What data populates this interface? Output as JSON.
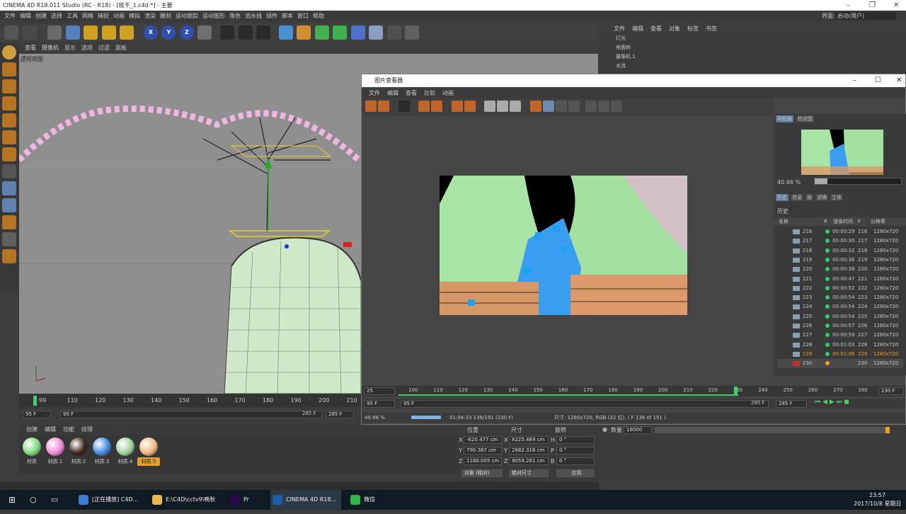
{
  "window": {
    "title": "CINEMA 4D R18.011 Studio (RC - R18) - [枝干_1.c4d *] - 主要",
    "interface_label": "界面:",
    "interface_value": "启动(用户)"
  },
  "menu": [
    "文件",
    "编辑",
    "创建",
    "选择",
    "工具",
    "网格",
    "捕捉",
    "动画",
    "模拟",
    "渲染",
    "雕刻",
    "运动跟踪",
    "运动图形",
    "角色",
    "流水线",
    "插件",
    "脚本",
    "窗口",
    "帮助"
  ],
  "toolbar_axes": [
    "X",
    "Y",
    "Z"
  ],
  "viewport": {
    "menu": [
      "查看",
      "摄像机",
      "显示",
      "选项",
      "过滤",
      "面板"
    ],
    "label": "透视视图"
  },
  "timeline": {
    "ticks": [
      "99",
      "110",
      "120",
      "130",
      "140",
      "150",
      "160",
      "170",
      "180",
      "190",
      "200",
      "210"
    ],
    "start": "95 F",
    "range_start": "95 F",
    "range_end": "285 F",
    "end": "285 F"
  },
  "object_panel": {
    "menu": [
      "文件",
      "编辑",
      "查看",
      "对象",
      "标签",
      "书签"
    ],
    "objects": [
      "灯光",
      "地面树",
      "摄像机.1",
      "水流"
    ]
  },
  "materials": {
    "menu": [
      "创建",
      "编辑",
      "功能",
      "纹理"
    ],
    "items": [
      {
        "name": "材质",
        "color": "#7ed87a"
      },
      {
        "name": "材质.1",
        "color": "#f08ad8"
      },
      {
        "name": "材质.2",
        "color": "#3a2418"
      },
      {
        "name": "材质.3",
        "color": "#3f8ae0"
      },
      {
        "name": "材质.4",
        "color": "#9ed29a"
      },
      {
        "name": "材质.5",
        "color": "#f0b67a"
      }
    ]
  },
  "viewer": {
    "title": "图片查看器",
    "menu": [
      "文件",
      "编辑",
      "查看",
      "比较",
      "动画"
    ],
    "nav_tabs": [
      "导航器",
      "柱状图"
    ],
    "zoom": "40.96 %",
    "hist_tabs": [
      "历史",
      "信息",
      "层",
      "滤镜",
      "立体"
    ],
    "hist_label": "历史",
    "hist_headers": [
      "名称",
      "R",
      "渲染时间",
      "F",
      "分辨率"
    ],
    "rows": [
      {
        "n": "216",
        "t": "00:00:29",
        "f": "216",
        "r": "1280x720"
      },
      {
        "n": "217",
        "t": "00:00:30",
        "f": "217",
        "r": "1280x720"
      },
      {
        "n": "218",
        "t": "00:00:32",
        "f": "218",
        "r": "1280x720"
      },
      {
        "n": "219",
        "t": "00:00:36",
        "f": "219",
        "r": "1280x720"
      },
      {
        "n": "220",
        "t": "00:00:38",
        "f": "220",
        "r": "1280x720"
      },
      {
        "n": "221",
        "t": "00:00:47",
        "f": "221",
        "r": "1280x720"
      },
      {
        "n": "222",
        "t": "00:00:52",
        "f": "222",
        "r": "1280x720"
      },
      {
        "n": "223",
        "t": "00:00:54",
        "f": "223",
        "r": "1280x720"
      },
      {
        "n": "224",
        "t": "00:00:54",
        "f": "224",
        "r": "1280x720"
      },
      {
        "n": "225",
        "t": "00:00:54",
        "f": "225",
        "r": "1280x720"
      },
      {
        "n": "226",
        "t": "00:00:57",
        "f": "226",
        "r": "1280x720"
      },
      {
        "n": "227",
        "t": "00:00:59",
        "f": "227",
        "r": "1280x720"
      },
      {
        "n": "228",
        "t": "00:01:03",
        "f": "228",
        "r": "1280x720"
      },
      {
        "n": "229",
        "t": "00:01:06",
        "f": "229",
        "r": "1280x720"
      },
      {
        "n": "230",
        "t": "",
        "f": "230",
        "r": "1280x720"
      }
    ],
    "timeline_start": "25",
    "ticks": [
      "100",
      "110",
      "120",
      "130",
      "140",
      "150",
      "160",
      "170",
      "180",
      "190",
      "200",
      "210",
      "220",
      "230",
      "240",
      "250",
      "260",
      "270",
      "280"
    ],
    "tl_end": "230 F",
    "range_start": "95 F",
    "range_mid": "95 F",
    "range_end": "285 F",
    "range_end2": "285 F",
    "status_zoom": "40.96 %",
    "status_time": "01:04:33 136/191 (230 F)",
    "status_info": "尺寸: 1280x720, RGB (32 位),  ( F 136 of 191 )"
  },
  "coords": {
    "headers": [
      "位置",
      "尺寸",
      "旋转"
    ],
    "px": "-620.477 cm",
    "py": "790.387 cm",
    "pz": "1180.005 cm",
    "sx": "8225.469 cm",
    "sy": "2882.318 cm",
    "sz": "9059.261 cm",
    "h": "0 °",
    "p": "0 °",
    "b": "0 °",
    "mode": "对象 (相对)",
    "size_mode": "绝对尺寸",
    "apply": "应用"
  },
  "attr": {
    "label": "数量",
    "value": "16000"
  },
  "taskbar": {
    "items": [
      {
        "label": "[正在播放] C4D...",
        "color": "#3a7bd5"
      },
      {
        "label": "E:\\C4D\\cctv9\\晚秋",
        "color": "#e8b84a"
      },
      {
        "label": "Pr",
        "color": "#2a0a4a"
      },
      {
        "label": "CINEMA 4D R18...",
        "color": "#1a5fa8"
      },
      {
        "label": "微信",
        "color": "#2eb84a"
      }
    ],
    "time": "23:57",
    "date": "2017/10/8 星期日"
  }
}
